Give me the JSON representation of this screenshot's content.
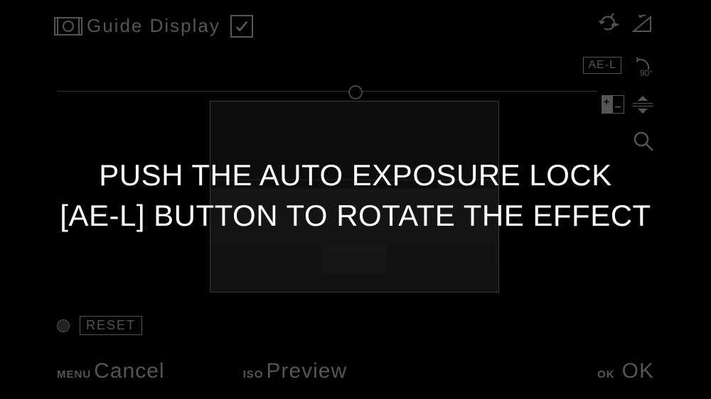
{
  "top": {
    "guide_display_label": "Guide Display",
    "checkbox_checked": true
  },
  "right": {
    "ael_label": "AE-L",
    "rotate_label": "90°"
  },
  "reset": {
    "label": "RESET"
  },
  "bottom": {
    "menu_key": "MENU",
    "menu_action": "Cancel",
    "iso_key": "ISO",
    "iso_action": "Preview",
    "ok_key": "OK",
    "ok_action": "OK"
  },
  "instruction": {
    "line1": "PUSH THE AUTO EXPOSURE LOCK",
    "line2": "[AE-L] BUTTON TO ROTATE THE EFFECT"
  }
}
